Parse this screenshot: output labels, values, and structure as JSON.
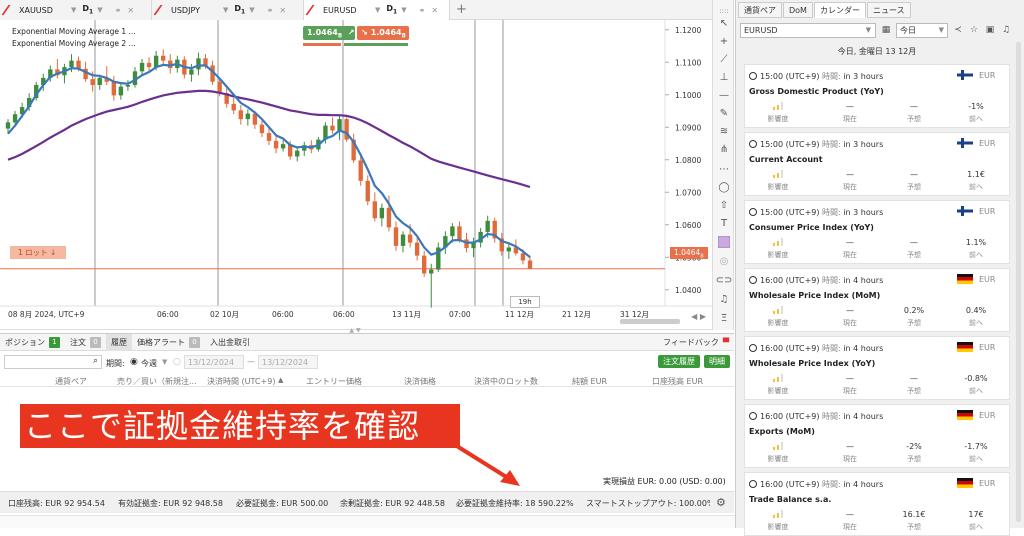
{
  "tabs": [
    {
      "symbol": "XAUUSD",
      "timeframe": "D",
      "tf_sub": "1"
    },
    {
      "symbol": "USDJPY",
      "timeframe": "D",
      "tf_sub": "1"
    },
    {
      "symbol": "EURUSD",
      "timeframe": "D",
      "tf_sub": "1"
    }
  ],
  "chart": {
    "legend": [
      "Exponential Moving Average 1 ...",
      "Exponential Moving Average 2 ..."
    ],
    "sell_price": "1.0464",
    "sell_price_sub": "8",
    "buy_price": "1.0464",
    "buy_price_sub": "8",
    "current_price": "1.0464",
    "current_price_sub": "8",
    "lot_label": "1 ロット",
    "y_ticks": [
      "1.1200",
      "1.1100",
      "1.1000",
      "1.0900",
      "1.0800",
      "1.0700",
      "1.0600",
      "1.0500",
      "1.0400"
    ],
    "x_ticks": [
      "08 8月 2024, UTC+9",
      "06:00",
      "02 10月",
      "06:00",
      "06:00",
      "13 11月",
      "07:00",
      "11 12月",
      "21 12月",
      "31 12月"
    ],
    "crosshair_label": "19h",
    "colors": {
      "ema1": "#3a78b8",
      "ema2": "#6b2f8f",
      "bull": "#3d8c3d",
      "bear": "#e06b3a",
      "price_line": "#e8704a"
    }
  },
  "chart_data": {
    "type": "candlestick",
    "candles": [
      [
        1.0896,
        1.0925,
        1.088,
        1.0915
      ],
      [
        1.0915,
        1.095,
        1.0905,
        1.094
      ],
      [
        1.094,
        1.0975,
        1.0928,
        1.0962
      ],
      [
        1.0962,
        1.1005,
        1.095,
        1.099
      ],
      [
        1.099,
        1.104,
        1.0982,
        1.103
      ],
      [
        1.103,
        1.1065,
        1.1012,
        1.1052
      ],
      [
        1.1052,
        1.109,
        1.104,
        1.1078
      ],
      [
        1.1078,
        1.111,
        1.105,
        1.106
      ],
      [
        1.106,
        1.1095,
        1.1035,
        1.1085
      ],
      [
        1.1085,
        1.1125,
        1.107,
        1.1105
      ],
      [
        1.1105,
        1.1118,
        1.1072,
        1.108
      ],
      [
        1.108,
        1.1102,
        1.104,
        1.1048
      ],
      [
        1.1048,
        1.1072,
        1.101,
        1.103
      ],
      [
        1.103,
        1.1062,
        1.1015,
        1.1052
      ],
      [
        1.1052,
        1.1088,
        1.103,
        1.104
      ],
      [
        1.104,
        1.1058,
        1.0982,
        1.0998
      ],
      [
        1.0998,
        1.1038,
        1.0985,
        1.1025
      ],
      [
        1.1025,
        1.1045,
        1.1012,
        1.103
      ],
      [
        1.103,
        1.1085,
        1.1022,
        1.1072
      ],
      [
        1.1072,
        1.111,
        1.106,
        1.1098
      ],
      [
        1.1098,
        1.1115,
        1.107,
        1.1085
      ],
      [
        1.1085,
        1.1135,
        1.1075,
        1.112
      ],
      [
        1.112,
        1.114,
        1.1092,
        1.1105
      ],
      [
        1.1105,
        1.1125,
        1.1065,
        1.1082
      ],
      [
        1.1082,
        1.112,
        1.1068,
        1.1108
      ],
      [
        1.1108,
        1.1118,
        1.105,
        1.1062
      ],
      [
        1.1062,
        1.1095,
        1.104,
        1.1078
      ],
      [
        1.1078,
        1.113,
        1.106,
        1.1112
      ],
      [
        1.1112,
        1.1125,
        1.108,
        1.109
      ],
      [
        1.109,
        1.1105,
        1.103,
        1.104
      ],
      [
        1.104,
        1.1052,
        1.0995,
        1.1005
      ],
      [
        1.1005,
        1.102,
        1.096,
        1.0972
      ],
      [
        1.0972,
        1.099,
        1.094,
        1.0952
      ],
      [
        1.0952,
        1.0968,
        1.0908,
        1.0925
      ],
      [
        1.0925,
        1.0955,
        1.0905,
        1.0942
      ],
      [
        1.0942,
        1.095,
        1.0895,
        1.0908
      ],
      [
        1.0908,
        1.092,
        1.087,
        1.0882
      ],
      [
        1.0882,
        1.09,
        1.0845,
        1.0858
      ],
      [
        1.0858,
        1.0872,
        1.082,
        1.0835
      ],
      [
        1.0835,
        1.086,
        1.0825,
        1.0848
      ],
      [
        1.0848,
        1.0858,
        1.08,
        1.081
      ],
      [
        1.081,
        1.084,
        1.0795,
        1.0828
      ],
      [
        1.0828,
        1.0855,
        1.0812,
        1.0845
      ],
      [
        1.0845,
        1.086,
        1.082,
        1.0832
      ],
      [
        1.0832,
        1.087,
        1.0825,
        1.0862
      ],
      [
        1.0862,
        1.0915,
        1.085,
        1.0905
      ],
      [
        1.0905,
        1.093,
        1.088,
        1.089
      ],
      [
        1.089,
        1.0935,
        1.086,
        1.0925
      ],
      [
        1.0925,
        1.093,
        1.0855,
        1.0862
      ],
      [
        1.0862,
        1.088,
        1.079,
        1.0798
      ],
      [
        1.0798,
        1.0815,
        1.072,
        1.0735
      ],
      [
        1.0735,
        1.0752,
        1.066,
        1.0672
      ],
      [
        1.0672,
        1.07,
        1.061,
        1.062
      ],
      [
        1.062,
        1.0665,
        1.0595,
        1.0652
      ],
      [
        1.0652,
        1.069,
        1.058,
        1.0592
      ],
      [
        1.0592,
        1.061,
        1.052,
        1.0535
      ],
      [
        1.0535,
        1.058,
        1.0515,
        1.057
      ],
      [
        1.057,
        1.0602,
        1.053,
        1.0545
      ],
      [
        1.0545,
        1.0565,
        1.049,
        1.0505
      ],
      [
        1.0505,
        1.052,
        1.044,
        1.045
      ],
      [
        1.045,
        1.048,
        1.0345,
        1.0462
      ],
      [
        1.0462,
        1.0545,
        1.0455,
        1.053
      ],
      [
        1.053,
        1.058,
        1.051,
        1.0565
      ],
      [
        1.0565,
        1.0605,
        1.0545,
        1.0595
      ],
      [
        1.0595,
        1.061,
        1.0545,
        1.0555
      ],
      [
        1.0555,
        1.0575,
        1.0515,
        1.0528
      ],
      [
        1.0528,
        1.056,
        1.05,
        1.0545
      ],
      [
        1.0545,
        1.059,
        1.053,
        1.0578
      ],
      [
        1.0578,
        1.0628,
        1.056,
        1.0612
      ],
      [
        1.0612,
        1.0622,
        1.0545,
        1.0558
      ],
      [
        1.0558,
        1.0575,
        1.0505,
        1.0518
      ],
      [
        1.0518,
        1.054,
        1.0495,
        1.053
      ],
      [
        1.053,
        1.0555,
        1.0505,
        1.0512
      ],
      [
        1.0512,
        1.0525,
        1.0478,
        1.049
      ],
      [
        1.049,
        1.0505,
        1.047,
        1.0465
      ]
    ],
    "ema1": [
      1.088,
      1.0905,
      1.0935,
      1.0965,
      1.1,
      1.103,
      1.1055,
      1.1065,
      1.1072,
      1.1082,
      1.108,
      1.107,
      1.106,
      1.1058,
      1.1052,
      1.104,
      1.1036,
      1.1034,
      1.1045,
      1.106,
      1.107,
      1.1085,
      1.1092,
      1.109,
      1.1095,
      1.1085,
      1.1082,
      1.109,
      1.109,
      1.1072,
      1.105,
      1.1025,
      1.1,
      1.0975,
      1.0962,
      1.0945,
      1.0925,
      1.09,
      1.0875,
      1.0865,
      1.0845,
      1.0838,
      1.084,
      1.0838,
      1.0845,
      1.0865,
      1.0873,
      1.089,
      1.0882,
      1.0855,
      1.0815,
      1.077,
      1.072,
      1.0697,
      1.0665,
      1.0625,
      1.0605,
      1.059,
      1.0565,
      1.053,
      1.0508,
      1.0515,
      1.0532,
      1.0552,
      1.0553,
      1.0545,
      1.0545,
      1.0555,
      1.0572,
      1.0568,
      1.055,
      1.0543,
      1.0533,
      1.0518,
      1.05
    ],
    "ema2": [
      1.08,
      1.0808,
      1.0818,
      1.083,
      1.0842,
      1.0855,
      1.0868,
      1.088,
      1.0892,
      1.0905,
      1.0915,
      1.0925,
      1.0933,
      1.0941,
      1.0948,
      1.0953,
      1.0958,
      1.0963,
      1.097,
      1.0978,
      1.0985,
      1.0992,
      1.0998,
      1.1002,
      1.1006,
      1.1008,
      1.101,
      1.1012,
      1.1012,
      1.101,
      1.1006,
      1.1001,
      1.0995,
      1.099,
      1.0986,
      1.0981,
      1.0976,
      1.097,
      1.0964,
      1.0958,
      1.0952,
      1.0948,
      1.0944,
      1.094,
      1.0938,
      1.0938,
      1.0937,
      1.0937,
      1.0935,
      1.093,
      1.0922,
      1.0912,
      1.09,
      1.0888,
      1.0876,
      1.0864,
      1.0852,
      1.0841,
      1.0829,
      1.0816,
      1.0803,
      1.0795,
      1.0788,
      1.0782,
      1.0776,
      1.077,
      1.0764,
      1.0758,
      1.0752,
      1.0746,
      1.074,
      1.0735,
      1.0729,
      1.0723,
      1.0716
    ],
    "ylim": [
      1.035,
      1.123
    ],
    "ylabel": ""
  },
  "toolbar": {
    "icons": [
      "cursor-icon",
      "crosshair-icon",
      "trendline-icon",
      "horizontal-line-icon",
      "horizontal-ray-icon",
      "brush-icon",
      "fib-icon",
      "pitchfork-icon",
      "path-icon",
      "ellipse-icon",
      "arrow-icon",
      "text-icon",
      "color-swatch-icon",
      "target-icon",
      "link-icon",
      "alert-bell-icon",
      "indicator-icon"
    ]
  },
  "trades": {
    "tabs": [
      {
        "label": "ポジション",
        "count": "1"
      },
      {
        "label": "注文",
        "count": "0"
      },
      {
        "label": "履歴",
        "count": ""
      },
      {
        "label": "価格アラート",
        "count": "0"
      },
      {
        "label": "入出金取引",
        "count": ""
      }
    ],
    "feedback_label": "フィードバック",
    "order_history_btn": "注文履歴",
    "statement_btn": "明細",
    "period_label": "期間:",
    "period_today": "今週",
    "date_from": "13/12/2024",
    "date_to": "13/12/2024",
    "columns": [
      "通貨ペア",
      "売り／買い（新規注...",
      "決済時間 (UTC+9)",
      "エントリー価格",
      "決済価格",
      "決済中のロット数",
      "純額 EUR",
      "口座残高 EUR"
    ],
    "realized_pnl": "実現損益 EUR: 0.00  (USD: 0.00)",
    "annotation": "ここで証拠金維持率を確認"
  },
  "statusbar": {
    "items": [
      "口座残高:  EUR 92 954.54",
      "有効証拠金:  EUR 92 948.58",
      "必要証拠金:  EUR 500.00",
      "余剰証拠金:  EUR 92 448.58",
      "必要証拠金維持率:  18 590.22%",
      "スマートストップアウト:  100.00%"
    ]
  },
  "calendar": {
    "tabs": [
      "通貨ペア",
      "DoM",
      "カレンダー",
      "ニュース"
    ],
    "active_tab": "カレンダー",
    "pair": "EURUSD",
    "date_select": "今日",
    "day_title": "今日, 金曜日 13 12月",
    "impact_label": "影響度",
    "actual_label": "現在",
    "forecast_label": "予想",
    "previous_label": "前へ",
    "events": [
      {
        "time": "15:00 (UTC+9)",
        "rel_label": "時間:",
        "rel": "in 3 hours",
        "country": "FI",
        "currency": "EUR",
        "name": "Gross Domestic Product (YoY)",
        "actual": "—",
        "forecast": "—",
        "previous": "-1%"
      },
      {
        "time": "15:00 (UTC+9)",
        "rel_label": "時間:",
        "rel": "in 3 hours",
        "country": "FI",
        "currency": "EUR",
        "name": "Current Account",
        "actual": "—",
        "forecast": "—",
        "previous": "1.1€"
      },
      {
        "time": "15:00 (UTC+9)",
        "rel_label": "時間:",
        "rel": "in 3 hours",
        "country": "FI",
        "currency": "EUR",
        "name": "Consumer Price Index (YoY)",
        "actual": "—",
        "forecast": "—",
        "previous": "1.1%"
      },
      {
        "time": "16:00 (UTC+9)",
        "rel_label": "時間:",
        "rel": "in 4 hours",
        "country": "DE",
        "currency": "EUR",
        "name": "Wholesale Price Index (MoM)",
        "actual": "—",
        "forecast": "0.2%",
        "previous": "0.4%"
      },
      {
        "time": "16:00 (UTC+9)",
        "rel_label": "時間:",
        "rel": "in 4 hours",
        "country": "DE",
        "currency": "EUR",
        "name": "Wholesale Price Index (YoY)",
        "actual": "—",
        "forecast": "—",
        "previous": "-0.8%"
      },
      {
        "time": "16:00 (UTC+9)",
        "rel_label": "時間:",
        "rel": "in 4 hours",
        "country": "DE",
        "currency": "EUR",
        "name": "Exports (MoM)",
        "actual": "—",
        "forecast": "-2%",
        "previous": "-1.7%"
      },
      {
        "time": "16:00 (UTC+9)",
        "rel_label": "時間:",
        "rel": "in 4 hours",
        "country": "DE",
        "currency": "EUR",
        "name": "Trade Balance s.a.",
        "actual": "—",
        "forecast": "16.1€",
        "previous": "17€"
      }
    ]
  }
}
